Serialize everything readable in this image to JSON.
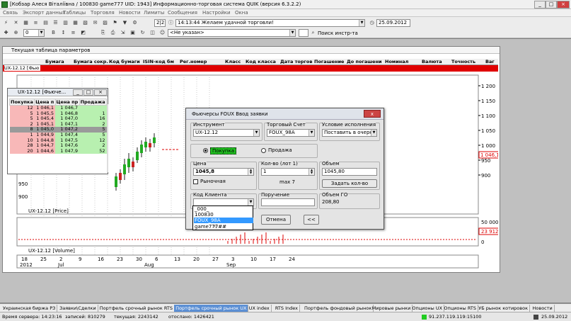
{
  "window": {
    "title": "[Кобзар Алеся Віталіївна / 100830 game777  UID: 1943] Информационно-торговая система QUIK (версия 6.3.2.2)"
  },
  "menu": [
    "Связь",
    "Экспорт данных",
    "Таблицы",
    "Торговля",
    "Новости",
    "Лимиты",
    "Сообщения",
    "Настройки",
    "Окна"
  ],
  "toolbar": {
    "counter": "2|2",
    "message": "14:13:44  Желаем удачной торговли!",
    "date": "25.09.2012",
    "account_select": "<Не указан>",
    "search_label": "Поиск инстр-та",
    "num_field": "0"
  },
  "params_table": {
    "title": "Текущая таблица параметров",
    "headers": [
      "Бумага",
      "Бумага сокр.",
      "Код бумаги",
      "ISIN-код бм",
      "Рег.номер",
      "Класс",
      "Код класса",
      "Дата торгов",
      "Погашение",
      "До погашени",
      "Номинал",
      "Валюта",
      "Точность",
      "Ваг"
    ],
    "row_label": "UX-12.12 [Фью"
  },
  "quotes": {
    "title": "UX-12.12 [Фьюче...",
    "headers": [
      "Покупка",
      "Цена п",
      "Цена пр",
      "Продажа"
    ],
    "rows": [
      {
        "buy": "12",
        "bid": "1 046,1",
        "ask": "1 046,7",
        "sell": ""
      },
      {
        "buy": "5",
        "bid": "1 045,5",
        "ask": "1 046,8",
        "sell": "1"
      },
      {
        "buy": "5",
        "bid": "1 045,4",
        "ask": "1 047,0",
        "sell": "16"
      },
      {
        "buy": "2",
        "bid": "1 045,1",
        "ask": "1 047,1",
        "sell": "2"
      },
      {
        "buy": "8",
        "bid": "1 045,0",
        "ask": "1 047,2",
        "sell": "5"
      },
      {
        "buy": "1",
        "bid": "1 044,9",
        "ask": "1 047,4",
        "sell": "5"
      },
      {
        "buy": "10",
        "bid": "1 044,8",
        "ask": "1 047,5",
        "sell": "12"
      },
      {
        "buy": "28",
        "bid": "1 044,7",
        "ask": "1 047,6",
        "sell": "2"
      },
      {
        "buy": "20",
        "bid": "1 044,6",
        "ask": "1 047,9",
        "sell": "52"
      }
    ]
  },
  "chart": {
    "price_label": "UX-12.12 [Price]",
    "volume_label": "UX-12.12 [Volume]",
    "y_ticks": [
      "1 200",
      "1 150",
      "1 100",
      "1 050",
      "1 000",
      "950",
      "900"
    ],
    "left_ticks": [
      "950",
      "900"
    ],
    "price_badge": "1 046,1",
    "volume_badge": "23 912",
    "volume_ticks": [
      "50 000",
      "0"
    ],
    "date_row1": [
      "18",
      "25",
      "2",
      "9",
      "16",
      "23",
      "30",
      "6",
      "13",
      "20",
      "27",
      "3",
      "10",
      "17",
      "24"
    ],
    "date_row2": [
      "2012",
      "Jul",
      "Aug",
      "Sep"
    ]
  },
  "dialog": {
    "title": "Фьючерсы FOUX Ввод заявки",
    "close": "x",
    "instrument_label": "Инструмент",
    "instrument_value": "UX-12.12",
    "account_label": "Торговый Счет",
    "account_value": "FOUX_98A",
    "condition_label": "Условие исполнения",
    "condition_value": "Поставить в очередь",
    "buy_label": "Покупка",
    "sell_label": "Продажа",
    "price_label": "Цена",
    "price_value": "1045,8",
    "market_label": "Рыночная",
    "qty_label": "Кол-во (лот 1)",
    "qty_value": "1",
    "max_label": "max 7",
    "volume_label": "Объем",
    "volume_value": "1045,80",
    "set_qty_button": "Задать кол-во",
    "client_code_label": "Код Клиента",
    "client_code_value": "",
    "assignment_label": "Поручение",
    "margin_label": "Объем ГО",
    "margin_value": "208,80",
    "cancel_button": "Отмена",
    "extra_button": "<<",
    "client_options": [
      "_000_",
      "100830",
      "FOUX_98A",
      "game777##"
    ],
    "client_selected_index": 2
  },
  "tabs": [
    "Украинская биржа РЗ",
    "Заявки\\Сделки",
    "Портфель срочный рынок RTS",
    "Портфель срочный рынок UX",
    "UX index",
    "RTS Index",
    "Портфель фондовый рынок",
    "Мировые рынки",
    "Опционы UX",
    "Опционы RTS",
    "УБ рынок котировок",
    "Новости"
  ],
  "active_tab_index": 3,
  "status": {
    "server_time": "Время сервера: 14:23:16",
    "records": "записей: 810279",
    "current": "текущая: 2243142",
    "sent": "отослано: 1426421",
    "connection": "91.237.119.119:15100",
    "date": "25.09.2012"
  },
  "colors": {
    "accent_red": "#e00000",
    "buy_green": "#b8f0b0",
    "sell_red": "#f8b8b8",
    "active_tab": "#5b8fd4"
  }
}
